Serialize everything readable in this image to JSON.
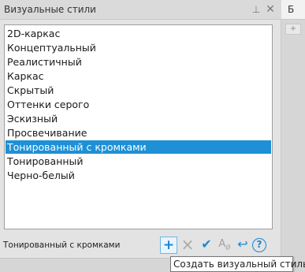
{
  "panel": {
    "title": "Визуальные стили",
    "pin_icon": "pin-icon",
    "close_icon": "close-icon"
  },
  "styles": [
    "2D-каркас",
    "Концептуальный",
    "Реалистичный",
    "Каркас",
    "Скрытый",
    "Оттенки серого",
    "Эскизный",
    "Просвечивание",
    "Тонированный с кромками",
    "Тонированный",
    "Черно-белый"
  ],
  "selected_index": 8,
  "status": {
    "current_style": "Тонированный с кромками"
  },
  "toolbar": {
    "create_icon": "plus-icon",
    "delete_icon": "x-icon",
    "apply_icon": "check-icon",
    "font_icon": "text-style-icon",
    "undo_icon": "undo-arrow-icon",
    "help_icon": "help-icon"
  },
  "tooltip": {
    "text": "Создать визуальный стиль"
  },
  "right_pane": {
    "tab_label": "Б",
    "button_label": "+"
  },
  "colors": {
    "selection": "#1e90d6",
    "accent": "#1c86d1"
  }
}
